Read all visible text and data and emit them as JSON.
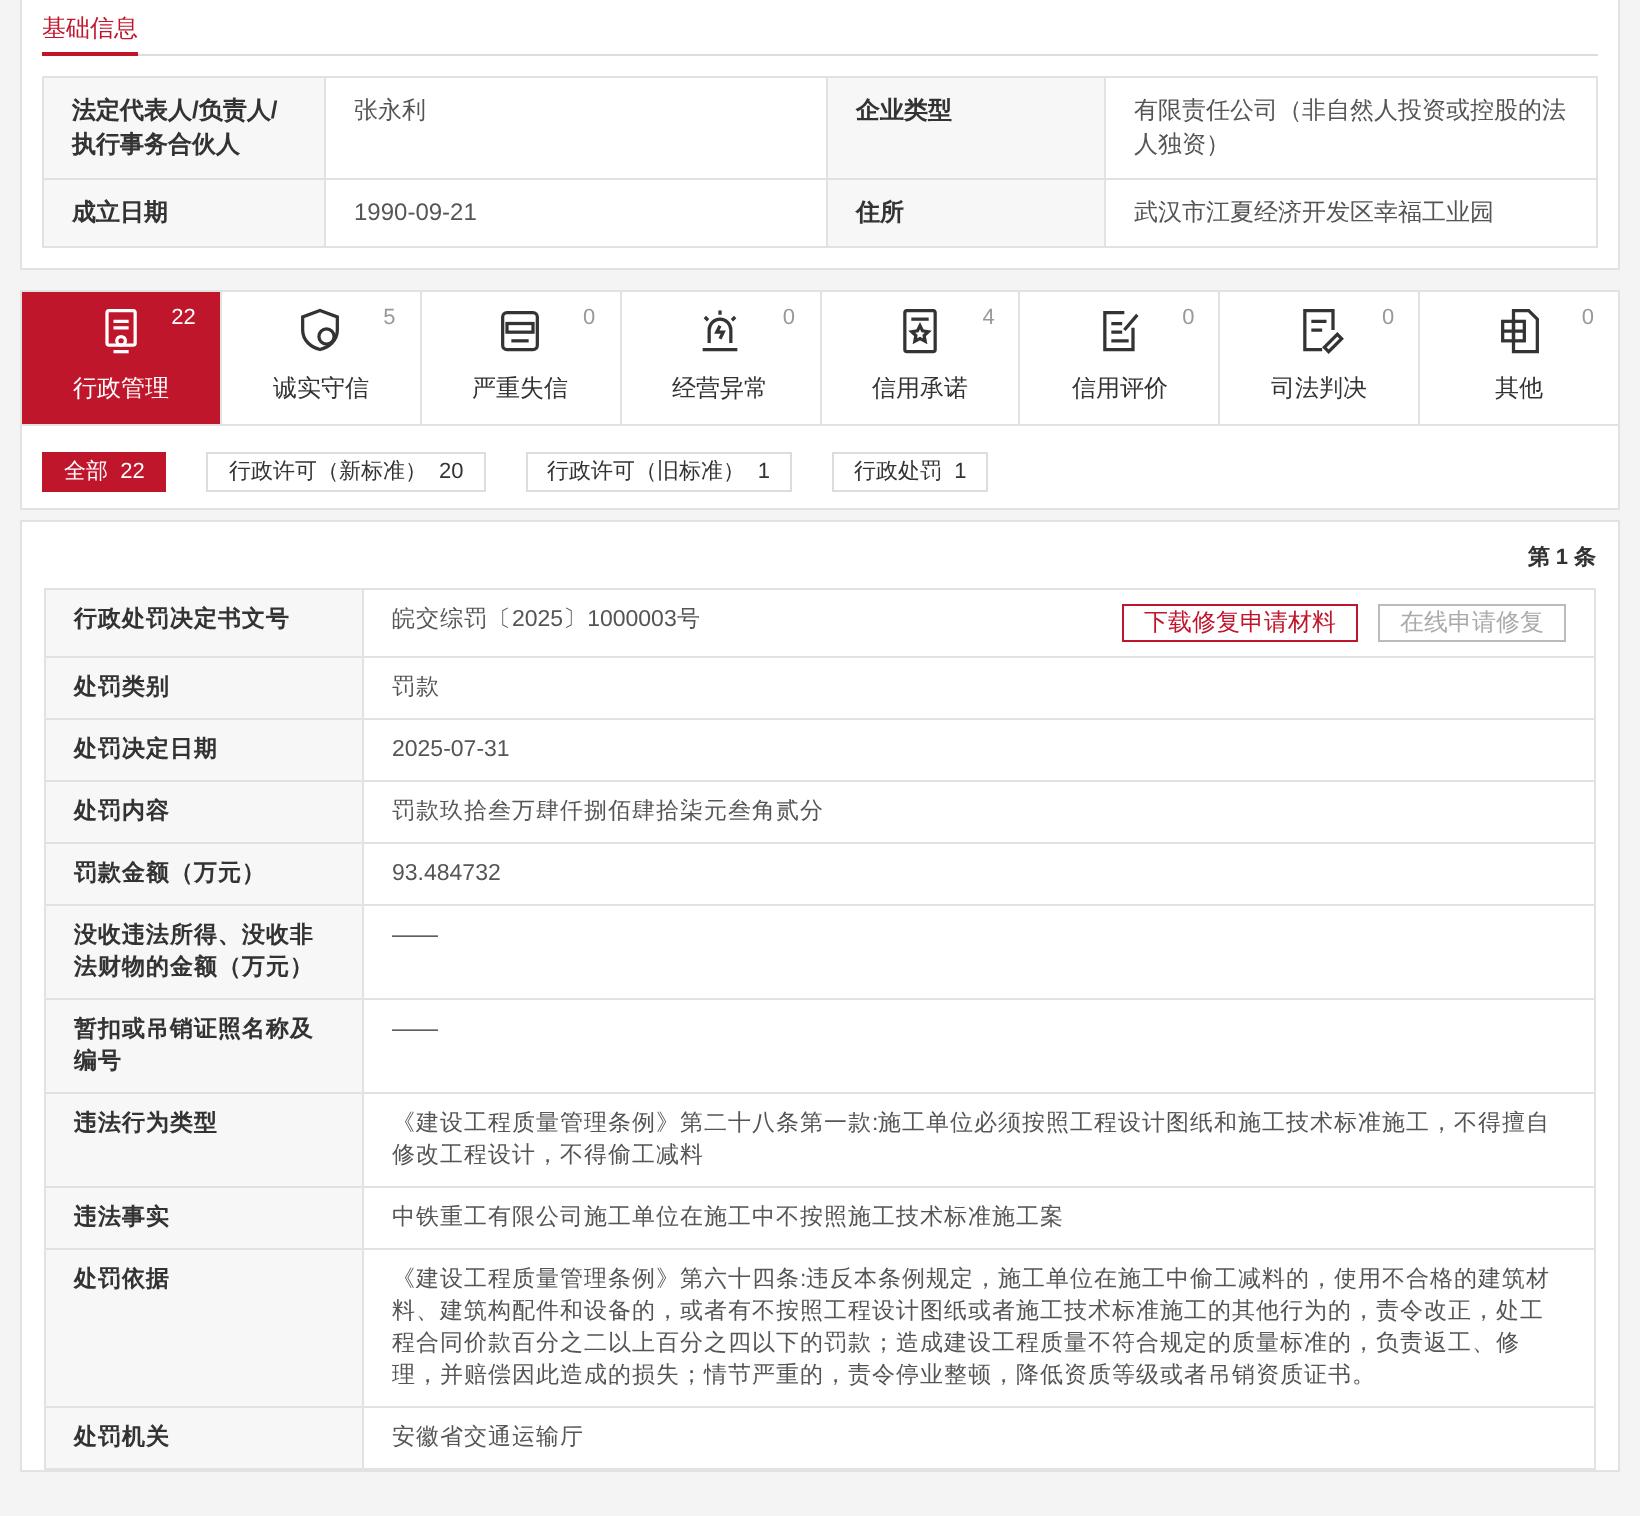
{
  "section_tab": {
    "label": "基础信息",
    "selected": true
  },
  "basic_info": [
    {
      "label": "法定代表人/负责人/执行事务合伙人",
      "value": "张永利"
    },
    {
      "label": "企业类型",
      "value": "有限责任公司（非自然人投资或控股的法人独资）"
    },
    {
      "label": "成立日期",
      "value": "1990-09-21"
    },
    {
      "label": "住所",
      "value": "武汉市江夏经济开发区幸福工业园"
    }
  ],
  "category_tabs": [
    {
      "label": "行政管理",
      "count": "22",
      "selected": true
    },
    {
      "label": "诚实守信",
      "count": "5",
      "selected": false
    },
    {
      "label": "严重失信",
      "count": "0",
      "selected": false
    },
    {
      "label": "经营异常",
      "count": "0",
      "selected": false
    },
    {
      "label": "信用承诺",
      "count": "4",
      "selected": false
    },
    {
      "label": "信用评价",
      "count": "0",
      "selected": false
    },
    {
      "label": "司法判决",
      "count": "0",
      "selected": false
    },
    {
      "label": "其他",
      "count": "0",
      "selected": false
    }
  ],
  "filters": [
    {
      "label": "全部",
      "count": "22",
      "selected": true
    },
    {
      "label": "行政许可（新标准）",
      "count": "20",
      "selected": false
    },
    {
      "label": "行政许可（旧标准）",
      "count": "1",
      "selected": false
    },
    {
      "label": "行政处罚",
      "count": "1",
      "selected": false
    }
  ],
  "record_index": "第 1 条",
  "record": [
    {
      "label": "行政处罚决定书文号",
      "value": "皖交综罚〔2025〕1000003号"
    },
    {
      "label": "处罚类别",
      "value": "罚款"
    },
    {
      "label": "处罚决定日期",
      "value": "2025-07-31"
    },
    {
      "label": "处罚内容",
      "value": "罚款玖拾叁万肆仟捌佰肆拾柒元叁角贰分"
    },
    {
      "label": "罚款金额（万元）",
      "value": "93.484732"
    },
    {
      "label": "没收违法所得、没收非法财物的金额（万元）",
      "value": "——"
    },
    {
      "label": "暂扣或吊销证照名称及编号",
      "value": "——"
    },
    {
      "label": "违法行为类型",
      "value": "《建设工程质量管理条例》第二十八条第一款:施工单位必须按照工程设计图纸和施工技术标准施工，不得擅自修改工程设计，不得偷工减料"
    },
    {
      "label": "违法事实",
      "value": "中铁重工有限公司施工单位在施工中不按照施工技术标准施工案"
    },
    {
      "label": "处罚依据",
      "value": "《建设工程质量管理条例》第六十四条:违反本条例规定，施工单位在施工中偷工减料的，使用不合格的建筑材料、建筑构配件和设备的，或者有不按照工程设计图纸或者施工技术标准施工的其他行为的，责令改正，处工程合同价款百分之二以上百分之四以下的罚款；造成建设工程质量不符合规定的质量标准的，负责返工、修理，并赔偿因此造成的损失；情节严重的，责令停业整顿，降低资质等级或者吊销资质证书。"
    },
    {
      "label": "处罚机关",
      "value": "安徽省交通运输厅"
    }
  ],
  "record_buttons": [
    {
      "label": "下载修复申请材料",
      "disabled": false
    },
    {
      "label": "在线申请修复",
      "disabled": true
    }
  ]
}
